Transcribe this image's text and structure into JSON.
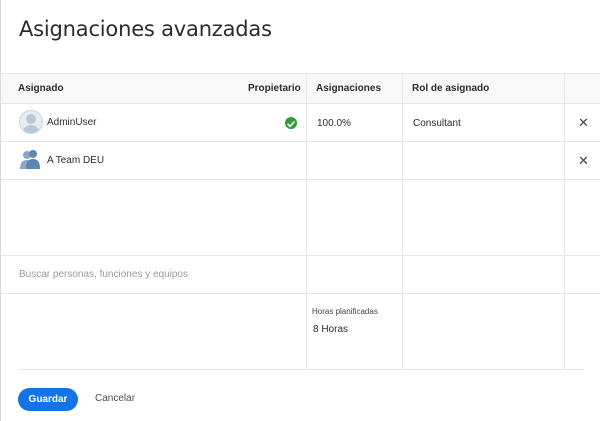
{
  "dialog": {
    "title": "Asignaciones avanzadas"
  },
  "table": {
    "headers": {
      "assignee": "Asignado",
      "owner": "Propietario",
      "allocations": "Asignaciones",
      "role": "Rol de asignado"
    },
    "rows": [
      {
        "name": "AdminUser",
        "owner": true,
        "allocation": "100.0%",
        "role": "Consultant",
        "avatar_icon": "user-avatar-icon"
      },
      {
        "name": "A Team DEU",
        "owner": false,
        "allocation": "",
        "role": "",
        "avatar_icon": "team-avatar-icon"
      }
    ],
    "search": {
      "placeholder": "Buscar personas, funciones y equipos"
    },
    "planned_hours": {
      "label": "Horas planificadas",
      "value": "8 Horas"
    }
  },
  "footer": {
    "save_label": "Guardar",
    "cancel_label": "Cancelar"
  },
  "colors": {
    "primary": "#1473e6",
    "owner_check": "#2d9d3a",
    "divider": "#e6e6e6",
    "header_bg": "#f8f8f8"
  }
}
